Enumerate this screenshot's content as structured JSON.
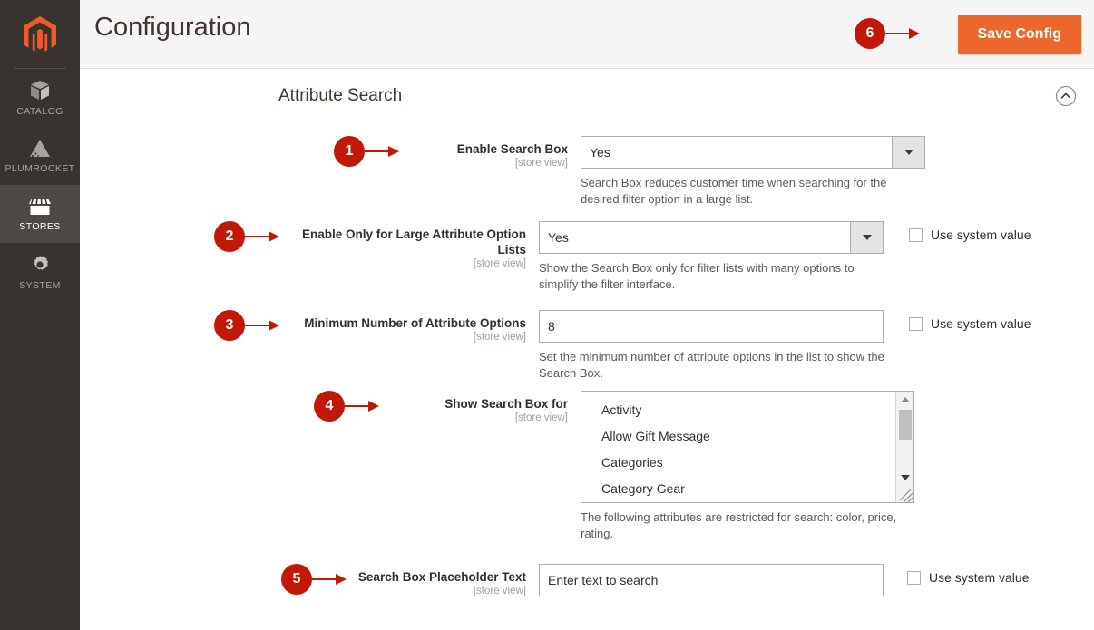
{
  "colors": {
    "sidebar_bg": "#373330",
    "accent_orange": "#ee672a",
    "badge_red": "#c21807",
    "header_bg": "#f5f5f5"
  },
  "sidebar": {
    "logo_name": "magento-logo-icon",
    "items": [
      {
        "label": "CATALOG",
        "icon": "box-icon",
        "active": false
      },
      {
        "label": "PLUMROCKET",
        "icon": "pyramid-icon",
        "active": false
      },
      {
        "label": "STORES",
        "icon": "storefront-icon",
        "active": true
      },
      {
        "label": "SYSTEM",
        "icon": "gear-icon",
        "active": false
      }
    ]
  },
  "header": {
    "title": "Configuration",
    "save_label": "Save Config",
    "save_badge": "6"
  },
  "section": {
    "title": "Attribute Search",
    "collapse_icon": "chevron-up-circle-icon"
  },
  "scope_text": "[store view]",
  "system_value_label": "Use system value",
  "fields": [
    {
      "badge": "1",
      "label": "Enable Search Box",
      "scope": "[store view]",
      "type": "select",
      "value": "Yes",
      "note": "Search Box reduces customer time when searching for the desired filter option in a large list.",
      "has_system_value": false
    },
    {
      "badge": "2",
      "label": "Enable Only for Large Attribute Option Lists",
      "scope": "[store view]",
      "type": "select",
      "value": "Yes",
      "note": "Show the Search Box only for filter lists with many options to simplify the filter interface.",
      "has_system_value": true
    },
    {
      "badge": "3",
      "label": "Minimum Number of Attribute Options",
      "scope": "[store view]",
      "type": "text",
      "value": "8",
      "note": "Set the minimum number of attribute options in the list to show the Search Box.",
      "has_system_value": true
    },
    {
      "badge": "4",
      "label": "Show Search Box for",
      "scope": "[store view]",
      "type": "multiselect",
      "options": [
        "Activity",
        "Allow Gift Message",
        "Categories",
        "Category Gear"
      ],
      "note": "The following attributes are restricted for search: color, price, rating.",
      "has_system_value": false
    },
    {
      "badge": "5",
      "label": "Search Box Placeholder Text",
      "scope": "[store view]",
      "type": "text",
      "value": "",
      "placeholder": "Enter text to search",
      "note": "",
      "has_system_value": true
    }
  ]
}
